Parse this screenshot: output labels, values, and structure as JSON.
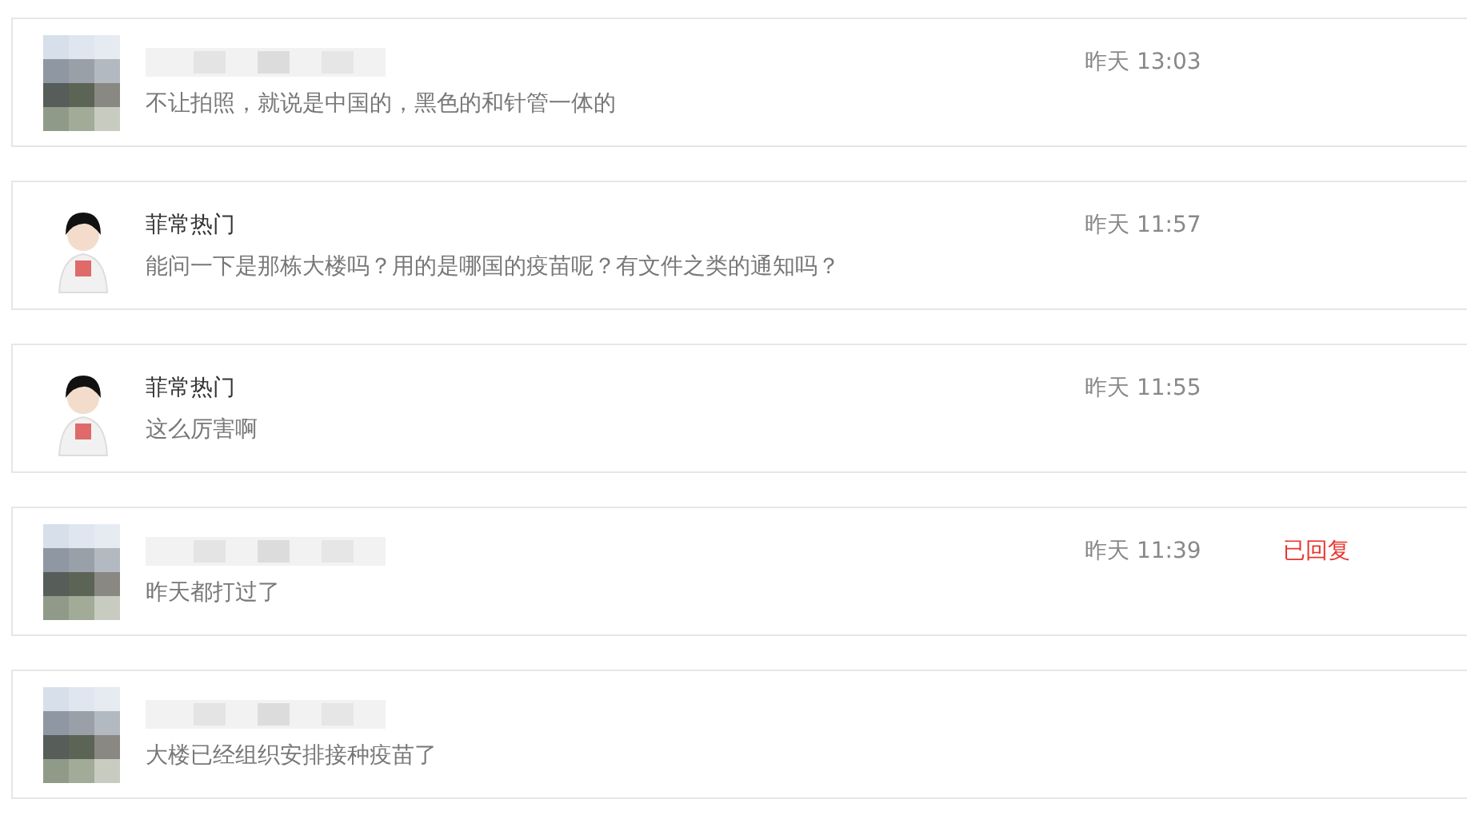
{
  "messages": [
    {
      "kind": "blurred",
      "message": "不让拍照，就说是中国的，黑色的和针管一体的",
      "time": "昨天 13:03"
    },
    {
      "kind": "user",
      "name": "菲常热门",
      "message": "能问一下是那栋大楼吗？用的是哪国的疫苗呢？有文件之类的通知吗？",
      "time": "昨天 11:57"
    },
    {
      "kind": "user",
      "name": "菲常热门",
      "message": "这么厉害啊",
      "time": "昨天 11:55"
    },
    {
      "kind": "blurred",
      "message": "昨天都打过了",
      "time": "昨天 11:39",
      "status": "已回复"
    },
    {
      "kind": "blurred",
      "message": "大楼已经组织安排接种疫苗了"
    }
  ]
}
